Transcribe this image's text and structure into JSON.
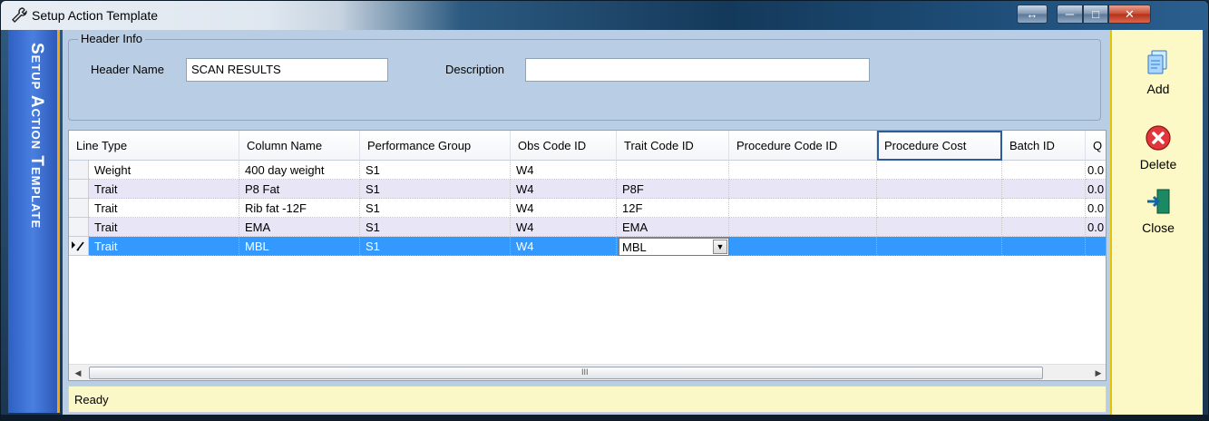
{
  "window": {
    "title": "Setup Action Template"
  },
  "banner": {
    "text": "Setup Action Template"
  },
  "header_info": {
    "group_label": "Header Info",
    "header_name_label": "Header Name",
    "header_name_value": "SCAN RESULTS",
    "description_label": "Description",
    "description_value": ""
  },
  "grid": {
    "columns": [
      "Line Type",
      "Column Name",
      "Performance Group",
      "Obs Code ID",
      "Trait Code ID",
      "Procedure Code ID",
      "Procedure Cost",
      "Batch ID",
      "Q"
    ],
    "rows": [
      {
        "line_type": "Weight",
        "column_name": "400 day weight",
        "performance_group": "S1",
        "obs_code_id": "W4",
        "trait_code_id": "",
        "procedure_code_id": "",
        "procedure_cost": "",
        "batch_id": "",
        "q": "0.0"
      },
      {
        "line_type": "Trait",
        "column_name": "P8 Fat",
        "performance_group": "S1",
        "obs_code_id": "W4",
        "trait_code_id": "P8F",
        "procedure_code_id": "",
        "procedure_cost": "",
        "batch_id": "",
        "q": "0.0"
      },
      {
        "line_type": "Trait",
        "column_name": "Rib fat -12F",
        "performance_group": "S1",
        "obs_code_id": "W4",
        "trait_code_id": "12F",
        "procedure_code_id": "",
        "procedure_cost": "",
        "batch_id": "",
        "q": "0.0"
      },
      {
        "line_type": "Trait",
        "column_name": "EMA",
        "performance_group": "S1",
        "obs_code_id": "W4",
        "trait_code_id": "EMA",
        "procedure_code_id": "",
        "procedure_cost": "",
        "batch_id": "",
        "q": "0.0"
      },
      {
        "line_type": "Trait",
        "column_name": "MBL",
        "performance_group": "S1",
        "obs_code_id": "W4",
        "trait_code_id": "MBL",
        "procedure_code_id": "",
        "procedure_cost": "",
        "batch_id": "",
        "q": ""
      }
    ],
    "scroll_grip": "III"
  },
  "status": {
    "text": "Ready"
  },
  "toolbar": {
    "add_label": "Add",
    "delete_label": "Delete",
    "close_label": "Close"
  },
  "colors": {
    "banner": "#3a6fd4",
    "selected_row": "#3399ff",
    "alt_row": "#e7e5f6",
    "status_bg": "#fbf8c8",
    "toolbar_bg": "#fcf9c6"
  }
}
